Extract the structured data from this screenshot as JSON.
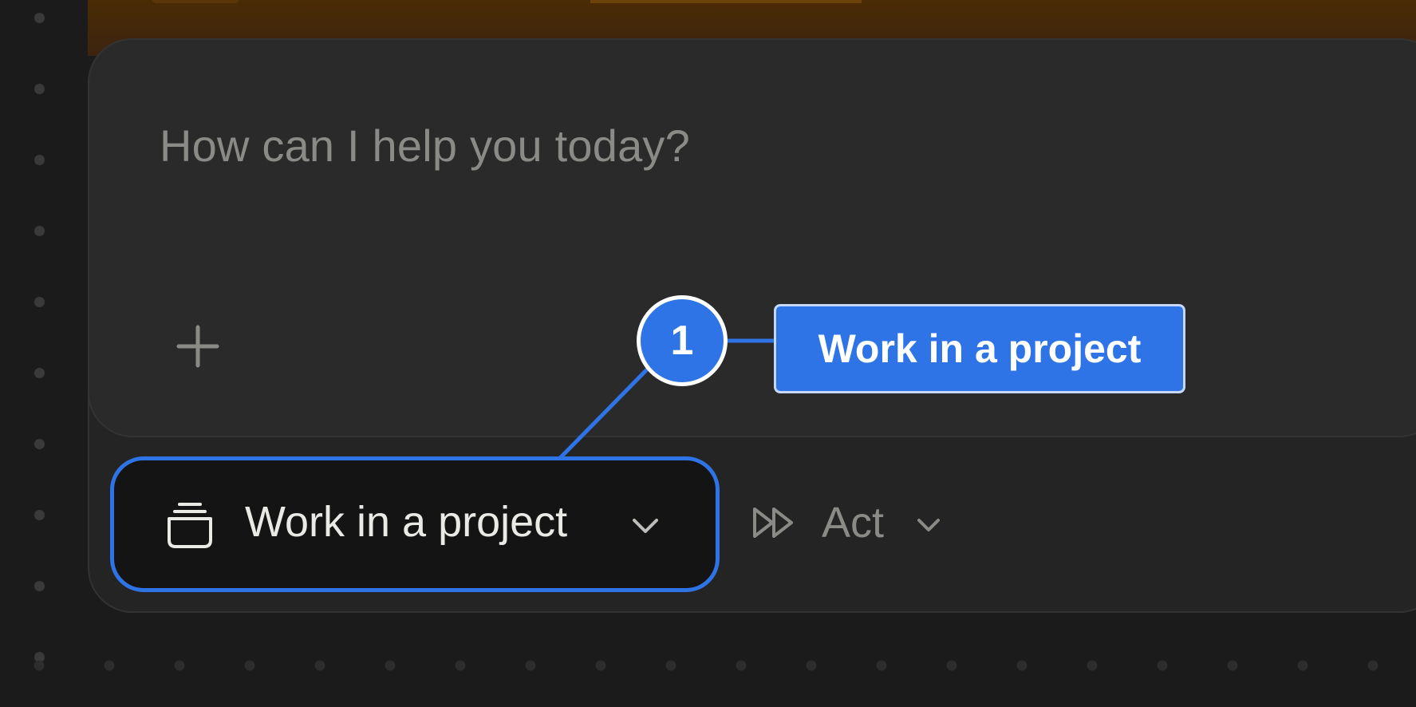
{
  "composer": {
    "placeholder": "How can I help you today?",
    "add_icon": "plus-icon"
  },
  "toolbar": {
    "project_button": {
      "label": "Work in a project",
      "icon": "folder-stack-icon",
      "chevron_icon": "chevron-down-icon"
    },
    "mode_button": {
      "label": "Act",
      "icon": "fast-forward-icon",
      "chevron_icon": "chevron-down-icon"
    }
  },
  "annotation": {
    "step_number": "1",
    "label": "Work in a project",
    "accent_color": "#2f74e6"
  },
  "colors": {
    "background": "#1b1b1b",
    "card": "#242424",
    "input": "#2a2a2a",
    "top_band": "#4a2b04"
  }
}
